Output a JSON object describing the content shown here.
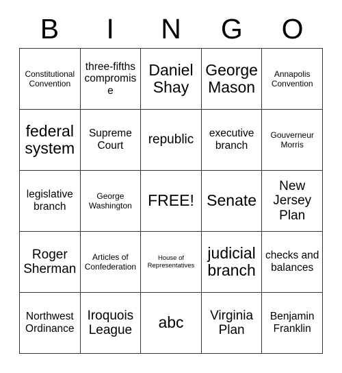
{
  "header": {
    "letters": [
      "B",
      "I",
      "N",
      "G",
      "O"
    ]
  },
  "grid": {
    "rows": 5,
    "columns": 5,
    "free_space_label": "FREE!",
    "cells": [
      [
        {
          "text": "Constitutional Convention",
          "size": "fs-sm"
        },
        {
          "text": "three-fifths compromise",
          "size": "fs-md"
        },
        {
          "text": "Daniel Shay",
          "size": "fs-xl"
        },
        {
          "text": "George Mason",
          "size": "fs-xl"
        },
        {
          "text": "Annapolis Convention",
          "size": "fs-sm"
        }
      ],
      [
        {
          "text": "federal system",
          "size": "fs-xl"
        },
        {
          "text": "Supreme Court",
          "size": "fs-md"
        },
        {
          "text": "republic",
          "size": "fs-lg"
        },
        {
          "text": "executive branch",
          "size": "fs-md"
        },
        {
          "text": "Gouverneur Morris",
          "size": "fs-sm"
        }
      ],
      [
        {
          "text": "legislative branch",
          "size": "fs-md"
        },
        {
          "text": "George Washington",
          "size": "fs-sm"
        },
        {
          "text": "FREE!",
          "size": "fs-xl"
        },
        {
          "text": "Senate",
          "size": "fs-xl"
        },
        {
          "text": "New Jersey Plan",
          "size": "fs-lg"
        }
      ],
      [
        {
          "text": "Roger Sherman",
          "size": "fs-lg"
        },
        {
          "text": "Articles of Confederation",
          "size": "fs-sm"
        },
        {
          "text": "House of Representatives",
          "size": "fs-xs"
        },
        {
          "text": "judicial branch",
          "size": "fs-xl"
        },
        {
          "text": "checks and balances",
          "size": "fs-md"
        }
      ],
      [
        {
          "text": "Northwest Ordinance",
          "size": "fs-md"
        },
        {
          "text": "Iroquois League",
          "size": "fs-lg"
        },
        {
          "text": "abc",
          "size": "fs-xl"
        },
        {
          "text": "Virginia Plan",
          "size": "fs-lg"
        },
        {
          "text": "Benjamin Franklin",
          "size": "fs-md"
        }
      ]
    ]
  },
  "colors": {
    "background": "#ffffff",
    "text": "#000000",
    "grid_line": "#333333"
  }
}
